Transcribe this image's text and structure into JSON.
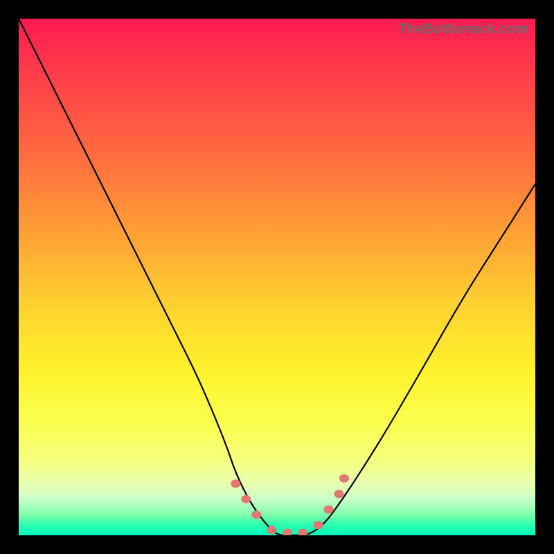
{
  "watermark": "TheBottleneck.com",
  "chart_data": {
    "type": "line",
    "title": "",
    "xlabel": "",
    "ylabel": "",
    "xlim": [
      0,
      1
    ],
    "ylim": [
      0,
      1
    ],
    "note": "Axes are unlabeled in the image; coordinates are normalized 0–1. y represents distance from the plot bottom (higher = warmer color / worse bottleneck).",
    "series": [
      {
        "name": "bottleneck-curve",
        "x": [
          0.0,
          0.05,
          0.1,
          0.15,
          0.2,
          0.25,
          0.3,
          0.35,
          0.4,
          0.42,
          0.45,
          0.48,
          0.5,
          0.53,
          0.56,
          0.59,
          0.62,
          0.66,
          0.71,
          0.78,
          0.86,
          0.93,
          1.0
        ],
        "y": [
          1.0,
          0.9,
          0.8,
          0.7,
          0.6,
          0.5,
          0.4,
          0.3,
          0.18,
          0.12,
          0.06,
          0.02,
          0.0,
          0.0,
          0.0,
          0.02,
          0.06,
          0.12,
          0.2,
          0.32,
          0.46,
          0.57,
          0.68
        ]
      }
    ],
    "markers": {
      "name": "highlighted-points",
      "x": [
        0.42,
        0.44,
        0.46,
        0.49,
        0.52,
        0.55,
        0.58,
        0.6,
        0.62,
        0.63
      ],
      "y": [
        0.1,
        0.07,
        0.04,
        0.01,
        0.005,
        0.005,
        0.02,
        0.05,
        0.08,
        0.11
      ]
    },
    "gradient_stops": [
      {
        "pos": 0.0,
        "color": "#ff1a52"
      },
      {
        "pos": 0.25,
        "color": "#ff6740"
      },
      {
        "pos": 0.55,
        "color": "#ffd030"
      },
      {
        "pos": 0.78,
        "color": "#faff4d"
      },
      {
        "pos": 0.96,
        "color": "#7fffaa"
      },
      {
        "pos": 1.0,
        "color": "#00ffbe"
      }
    ]
  }
}
